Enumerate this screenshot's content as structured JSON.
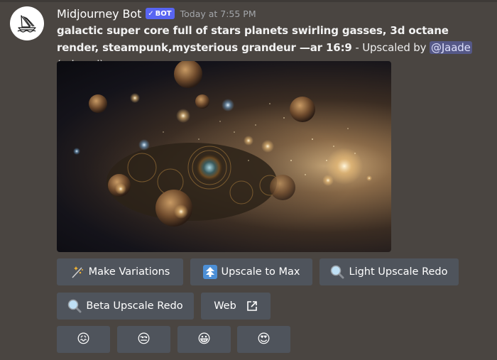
{
  "message": {
    "author": "Midjourney Bot",
    "badge": "BOT",
    "badge_check": "✓",
    "timestamp": "Today at 7:55 PM",
    "prompt_line": "galactic super core full of stars planets swirling gasses, 3d octane render, steampunk,mysterious grandeur —ar 16:9",
    "suffix_before": " - Upscaled by ",
    "mention": "@Jaade",
    "suffix_after": " (relaxed)",
    "image_alt": "galactic super core steampunk render"
  },
  "buttons": {
    "make_variations": {
      "label": "Make Variations",
      "icon": "magic-wand-icon"
    },
    "upscale_to_max": {
      "label": "Upscale to Max",
      "icon": "arrow-up-double-icon"
    },
    "light_upscale_redo": {
      "label": "Light Upscale Redo",
      "icon": "magnifier-icon"
    },
    "beta_upscale_redo": {
      "label": "Beta Upscale Redo",
      "icon": "magnifier-icon"
    },
    "web": {
      "label": "Web",
      "icon": "external-link-icon"
    }
  },
  "reactions": [
    {
      "name": "confounded-face",
      "glyph": "😖"
    },
    {
      "name": "unamused-face",
      "glyph": "😒"
    },
    {
      "name": "grinning-face",
      "glyph": "😀"
    },
    {
      "name": "heart-eyes-face",
      "glyph": "😍"
    }
  ],
  "colors": {
    "background": "#4a4541",
    "button": "#4f545c",
    "bot_badge": "#5865f2",
    "mention_bg": "#555887"
  }
}
